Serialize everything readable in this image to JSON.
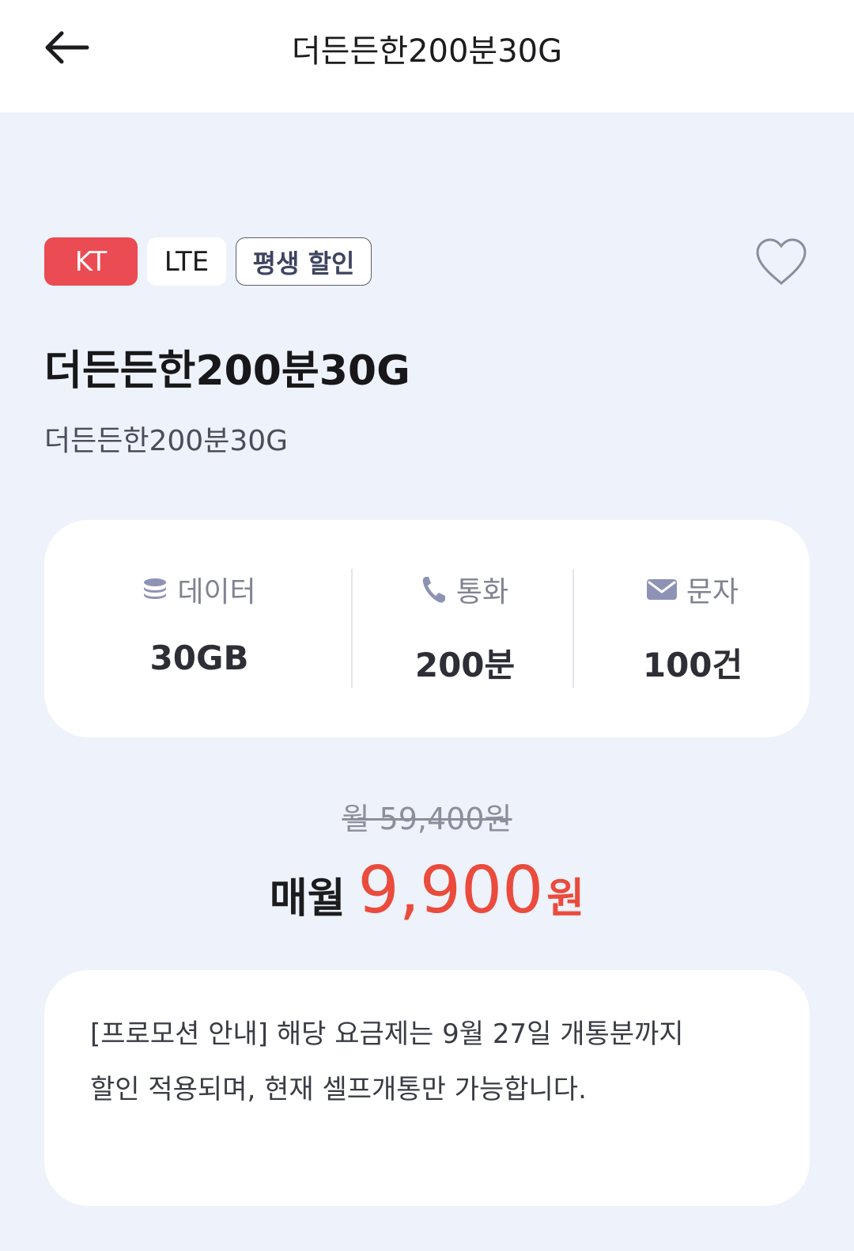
{
  "header": {
    "title": "더든든한200분30G"
  },
  "badges": [
    "KT",
    "LTE",
    "평생 할인"
  ],
  "plan": {
    "title": "더든든한200분30G",
    "subtitle": "더든든한200분30G"
  },
  "specs": [
    {
      "icon": "database-icon",
      "label": "데이터",
      "value": "30GB"
    },
    {
      "icon": "phone-icon",
      "label": "통화",
      "value": "200분"
    },
    {
      "icon": "mail-icon",
      "label": "문자",
      "value": "100건"
    }
  ],
  "price": {
    "original": "월 59,400원",
    "monthly_label": "매월",
    "amount": "9,900",
    "unit": "원"
  },
  "notice": {
    "text": "[프로모션 안내] 해당 요금제는 9월 27일 개통분까지 할인 적용되며, 현재 셀프개통만 가능합니다."
  },
  "colors": {
    "accent": "#ea4b3c",
    "kt_badge": "#eb4b53",
    "background": "#eef2fa",
    "icon": "#8e93b5"
  }
}
